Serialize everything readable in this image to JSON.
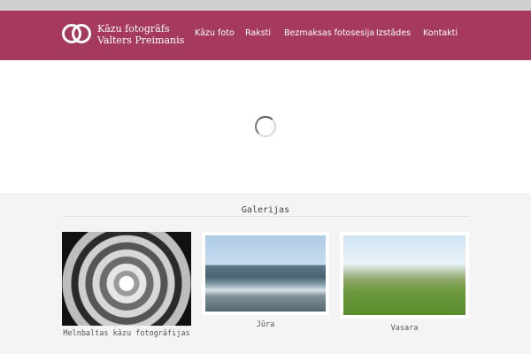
{
  "header": {
    "logo_line1": "Kāzu fotogrāfs",
    "logo_line2": "Valters Preimanis",
    "nav": [
      "Kāzu foto",
      "Raksti",
      "Bezmaksas fotosesija",
      "Izstādes",
      "Kontakti"
    ]
  },
  "hero": {
    "spinner_icon": "loading-spinner-icon"
  },
  "gallery": {
    "title": "Galerijas",
    "items": [
      {
        "label": "Melnbaltas kāzu fotogrāfijas"
      },
      {
        "label": "Jūra"
      },
      {
        "label": "Vasara"
      }
    ]
  },
  "colors": {
    "header_bg": "#a63a5c",
    "top_strip": "#cfcfcf",
    "gallery_bg": "#f4f4f4"
  }
}
